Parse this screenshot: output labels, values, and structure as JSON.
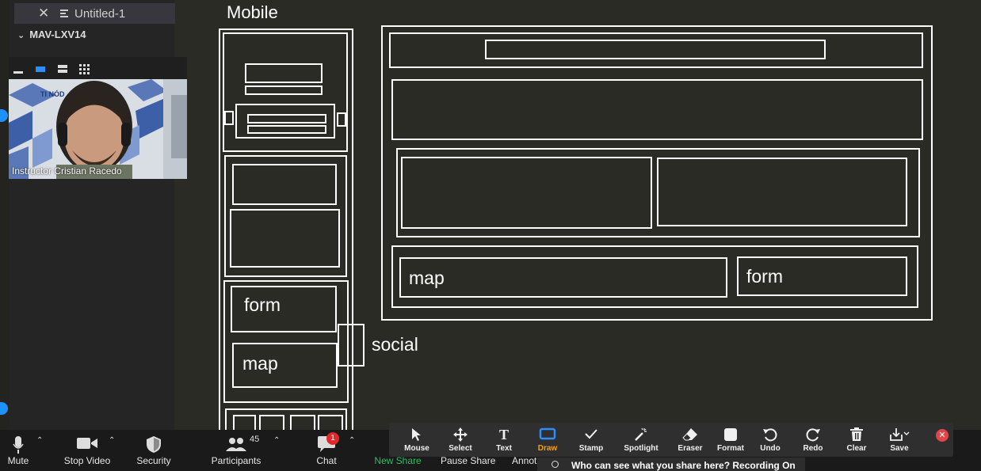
{
  "editor": {
    "tab_label": "Untitled-1",
    "folder_label": "MAV-LXV14",
    "close_glyph": "✕",
    "chevron_glyph": "⌄"
  },
  "video": {
    "participant_name": "Instructor Cristian Racedo",
    "background_logo": "TI NÓD"
  },
  "whiteboard": {
    "mobile_label": "Mobile",
    "labels": {
      "form_mobile": "form",
      "map_mobile": "map",
      "social": "social",
      "map_desktop": "map",
      "form_desktop": "form"
    }
  },
  "toolbar": {
    "items": [
      {
        "label": "Mute",
        "icon": "microphone-icon"
      },
      {
        "label": "Stop Video",
        "icon": "video-camera-icon"
      },
      {
        "label": "Security",
        "icon": "shield-icon"
      },
      {
        "label": "Participants",
        "icon": "participants-icon",
        "count": "45"
      },
      {
        "label": "Chat",
        "icon": "chat-icon",
        "badge": "1"
      },
      {
        "label": "New Share",
        "icon": "share-icon"
      },
      {
        "label": "Pause Share",
        "icon": "pause-icon"
      },
      {
        "label": "Annot",
        "icon": "annotate-icon"
      }
    ],
    "new_share_color": "#2dbe60"
  },
  "annotation": {
    "items": [
      {
        "label": "Mouse",
        "icon": "cursor-icon"
      },
      {
        "label": "Select",
        "icon": "move-icon"
      },
      {
        "label": "Text",
        "icon": "text-icon"
      },
      {
        "label": "Draw",
        "icon": "draw-icon",
        "active": true
      },
      {
        "label": "Stamp",
        "icon": "checkmark-icon"
      },
      {
        "label": "Spotlight",
        "icon": "spotlight-icon"
      },
      {
        "label": "Eraser",
        "icon": "eraser-icon"
      },
      {
        "label": "Format",
        "icon": "format-icon"
      },
      {
        "label": "Undo",
        "icon": "undo-icon"
      },
      {
        "label": "Redo",
        "icon": "redo-icon"
      },
      {
        "label": "Clear",
        "icon": "trash-icon"
      },
      {
        "label": "Save",
        "icon": "save-icon"
      }
    ],
    "active_color": "#f0a020",
    "close_glyph": "✕"
  },
  "recording_notice": "Who can see what you share here? Recording On"
}
